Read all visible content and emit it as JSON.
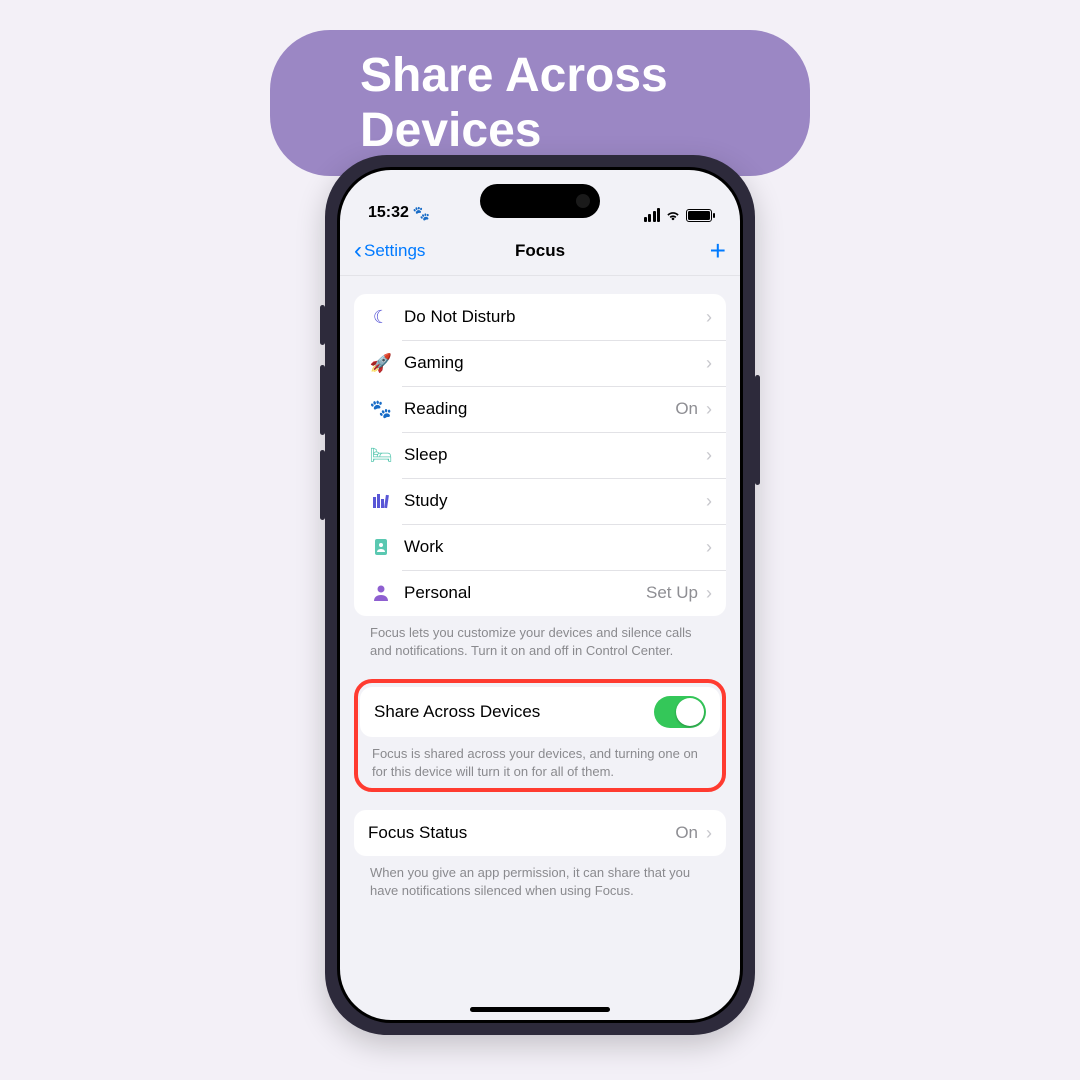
{
  "page_title": "Share Across Devices",
  "status": {
    "time": "15:32"
  },
  "nav": {
    "back": "Settings",
    "title": "Focus"
  },
  "focus_items": [
    {
      "label": "Do Not Disturb",
      "value": ""
    },
    {
      "label": "Gaming",
      "value": ""
    },
    {
      "label": "Reading",
      "value": "On"
    },
    {
      "label": "Sleep",
      "value": ""
    },
    {
      "label": "Study",
      "value": ""
    },
    {
      "label": "Work",
      "value": ""
    },
    {
      "label": "Personal",
      "value": "Set Up"
    }
  ],
  "focus_footer": "Focus lets you customize your devices and silence calls and notifications. Turn it on and off in Control Center.",
  "share": {
    "label": "Share Across Devices",
    "footer": "Focus is shared across your devices, and turning one on for this device will turn it on for all of them."
  },
  "focus_status": {
    "label": "Focus Status",
    "value": "On",
    "footer": "When you give an app permission, it can share that you have notifications silenced when using Focus."
  }
}
